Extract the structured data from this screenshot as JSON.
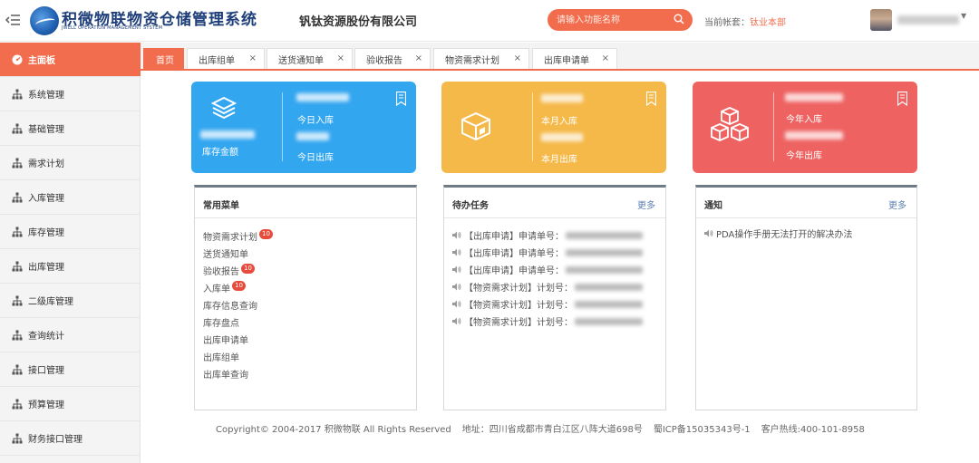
{
  "header": {
    "app_title": "积微物联物资仓储管理系统",
    "app_subtitle": "JWELL OPERATION MANAGEMENT SYSTEM",
    "company": "钒钛资源股份有限公司",
    "search_placeholder": "请输入功能名称",
    "account_label": "当前帐套：",
    "account_value": "钛业本部",
    "icons": {
      "menu": "menu-toggle-icon",
      "search": "search-icon",
      "caret": "chevron-down-icon"
    }
  },
  "sidebar": {
    "items": [
      {
        "label": "主面板",
        "active": true,
        "icon": "dashboard-icon"
      },
      {
        "label": "系统管理",
        "icon": "sitemap-icon"
      },
      {
        "label": "基础管理",
        "icon": "sitemap-icon"
      },
      {
        "label": "需求计划",
        "icon": "sitemap-icon"
      },
      {
        "label": "入库管理",
        "icon": "sitemap-icon"
      },
      {
        "label": "库存管理",
        "icon": "sitemap-icon"
      },
      {
        "label": "出库管理",
        "icon": "sitemap-icon"
      },
      {
        "label": "二级库管理",
        "icon": "sitemap-icon"
      },
      {
        "label": "查询统计",
        "icon": "sitemap-icon"
      },
      {
        "label": "接口管理",
        "icon": "sitemap-icon"
      },
      {
        "label": "预算管理",
        "icon": "sitemap-icon"
      },
      {
        "label": "财务接口管理",
        "icon": "sitemap-icon"
      }
    ]
  },
  "tabs": [
    {
      "label": "首页",
      "closable": false,
      "active": true
    },
    {
      "label": "出库组单",
      "closable": true,
      "close": "×"
    },
    {
      "label": "送货通知单",
      "closable": true,
      "close": "×"
    },
    {
      "label": "验收报告",
      "closable": true,
      "close": "×"
    },
    {
      "label": "物资需求计划",
      "closable": true,
      "close": "×"
    },
    {
      "label": "出库申请单",
      "closable": true,
      "close": "×"
    }
  ],
  "cards": {
    "blue": {
      "color": "#33a6f0",
      "main_label": "库存金额",
      "top_label": "今日入库",
      "bottom_label": "今日出库",
      "icon": "layers-icon"
    },
    "yellow": {
      "color": "#f5b94a",
      "top_label": "本月入库",
      "bottom_label": "本月出库",
      "icon": "package-icon"
    },
    "red": {
      "color": "#ee6261",
      "top_label": "今年入库",
      "bottom_label": "今年出库",
      "icon": "boxes-icon"
    }
  },
  "common_menu": {
    "title": "常用菜单",
    "links": [
      {
        "label": "物资需求计划",
        "badge": "10"
      },
      {
        "label": "送货通知单"
      },
      {
        "label": "验收报告",
        "badge": "10"
      },
      {
        "label": "入库单",
        "badge": "10"
      },
      {
        "label": "库存信息查询"
      },
      {
        "label": "库存盘点"
      },
      {
        "label": "出库申请单"
      },
      {
        "label": "出库组单"
      },
      {
        "label": "出库单查询"
      }
    ]
  },
  "todo": {
    "title": "待办任务",
    "more": "更多",
    "items": [
      {
        "label": "【出库申请】申请单号："
      },
      {
        "label": "【出库申请】申请单号："
      },
      {
        "label": "【出库申请】申请单号："
      },
      {
        "label": "【物资需求计划】计划号："
      },
      {
        "label": "【物资需求计划】计划号："
      },
      {
        "label": "【物资需求计划】计划号："
      }
    ]
  },
  "notice": {
    "title": "通知",
    "more": "更多",
    "items": [
      {
        "label": "PDA操作手册无法打开的解决办法"
      }
    ]
  },
  "footer": {
    "copyright": "Copyright© 2004-2017 积微物联 All Rights Reserved",
    "address": "地址：四川省成都市青白江区八阵大道698号",
    "icp": "蜀ICP备15035343号-1",
    "hotline": "客户热线:400-101-8958"
  },
  "colors": {
    "accent": "#f26d4e",
    "panel_border": "#6f7b86",
    "badge": "#e74b3c"
  }
}
